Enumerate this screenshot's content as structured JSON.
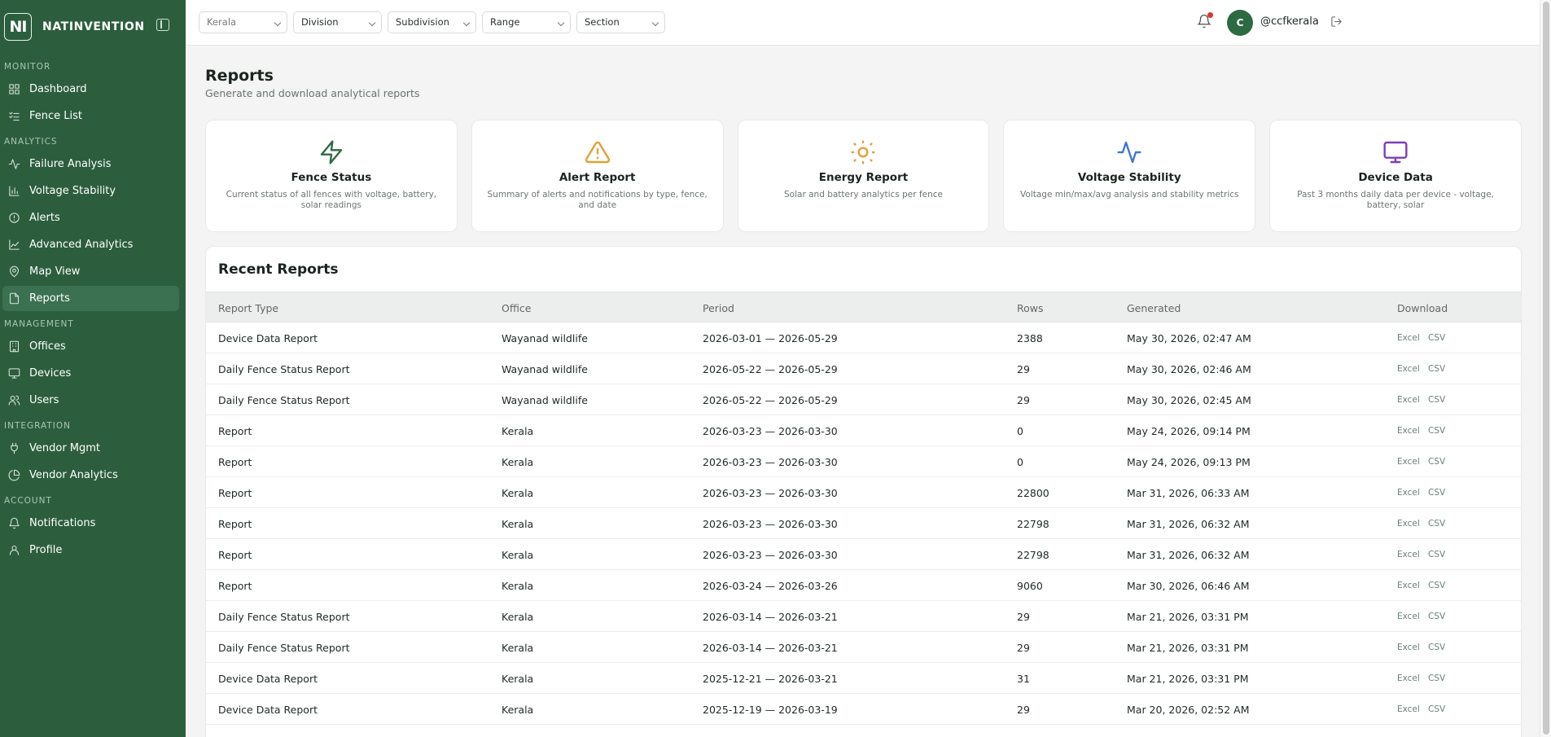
{
  "brand": {
    "logo": "NI",
    "name": "NATINVENTION"
  },
  "sidebar": {
    "sections": [
      {
        "label": "MONITOR",
        "items": [
          {
            "label": "Dashboard",
            "icon": "grid-icon"
          },
          {
            "label": "Fence List",
            "icon": "list-icon"
          }
        ]
      },
      {
        "label": "ANALYTICS",
        "items": [
          {
            "label": "Failure Analysis",
            "icon": "activity-icon"
          },
          {
            "label": "Voltage Stability",
            "icon": "bar-chart-icon"
          },
          {
            "label": "Alerts",
            "icon": "alert-circle-icon"
          },
          {
            "label": "Advanced Analytics",
            "icon": "line-chart-icon"
          },
          {
            "label": "Map View",
            "icon": "map-pin-icon"
          },
          {
            "label": "Reports",
            "icon": "file-icon",
            "active": true
          }
        ]
      },
      {
        "label": "MANAGEMENT",
        "items": [
          {
            "label": "Offices",
            "icon": "building-icon"
          },
          {
            "label": "Devices",
            "icon": "monitor-icon"
          },
          {
            "label": "Users",
            "icon": "users-icon"
          }
        ]
      },
      {
        "label": "INTEGRATION",
        "items": [
          {
            "label": "Vendor Mgmt",
            "icon": "plug-icon"
          },
          {
            "label": "Vendor Analytics",
            "icon": "pie-chart-icon"
          }
        ]
      },
      {
        "label": "ACCOUNT",
        "items": [
          {
            "label": "Notifications",
            "icon": "bell-icon"
          },
          {
            "label": "Profile",
            "icon": "user-icon"
          }
        ]
      }
    ]
  },
  "topbar": {
    "filters": [
      "Kerala",
      "Division",
      "Subdivision",
      "Range",
      "Section"
    ],
    "avatar_initial": "C",
    "username": "@ccfkerala"
  },
  "page": {
    "title": "Reports",
    "subtitle": "Generate and download analytical reports"
  },
  "cards": [
    {
      "title": "Fence Status",
      "desc": "Current status of all fences with voltage, battery, solar readings",
      "icon": "zap-icon",
      "color": "#2f6a47"
    },
    {
      "title": "Alert Report",
      "desc": "Summary of alerts and notifications by type, fence, and date",
      "icon": "warning-triangle-icon",
      "color": "#e0a13a"
    },
    {
      "title": "Energy Report",
      "desc": "Solar and battery analytics per fence",
      "icon": "sun-icon",
      "color": "#e0a13a"
    },
    {
      "title": "Voltage Stability",
      "desc": "Voltage min/max/avg analysis and stability metrics",
      "icon": "pulse-icon",
      "color": "#3f78c9"
    },
    {
      "title": "Device Data",
      "desc": "Past 3 months daily data per device - voltage, battery, solar",
      "icon": "monitor-icon",
      "color": "#7a3fb8"
    }
  ],
  "recent": {
    "title": "Recent Reports",
    "headers": [
      "Report Type",
      "Office",
      "Period",
      "Rows",
      "Generated",
      "Download"
    ],
    "download_labels": [
      "Excel",
      "CSV"
    ],
    "rows": [
      [
        "Device Data Report",
        "Wayanad wildlife",
        "2026-03-01 — 2026-05-29",
        "2388",
        "May 30, 2026, 02:47 AM"
      ],
      [
        "Daily Fence Status Report",
        "Wayanad wildlife",
        "2026-05-22 — 2026-05-29",
        "29",
        "May 30, 2026, 02:46 AM"
      ],
      [
        "Daily Fence Status Report",
        "Wayanad wildlife",
        "2026-05-22 — 2026-05-29",
        "29",
        "May 30, 2026, 02:45 AM"
      ],
      [
        "Report",
        "Kerala",
        "2026-03-23 — 2026-03-30",
        "0",
        "May 24, 2026, 09:14 PM"
      ],
      [
        "Report",
        "Kerala",
        "2026-03-23 — 2026-03-30",
        "0",
        "May 24, 2026, 09:13 PM"
      ],
      [
        "Report",
        "Kerala",
        "2026-03-23 — 2026-03-30",
        "22800",
        "Mar 31, 2026, 06:33 AM"
      ],
      [
        "Report",
        "Kerala",
        "2026-03-23 — 2026-03-30",
        "22798",
        "Mar 31, 2026, 06:32 AM"
      ],
      [
        "Report",
        "Kerala",
        "2026-03-23 — 2026-03-30",
        "22798",
        "Mar 31, 2026, 06:32 AM"
      ],
      [
        "Report",
        "Kerala",
        "2026-03-24 — 2026-03-26",
        "9060",
        "Mar 30, 2026, 06:46 AM"
      ],
      [
        "Daily Fence Status Report",
        "Kerala",
        "2026-03-14 — 2026-03-21",
        "29",
        "Mar 21, 2026, 03:31 PM"
      ],
      [
        "Daily Fence Status Report",
        "Kerala",
        "2026-03-14 — 2026-03-21",
        "29",
        "Mar 21, 2026, 03:31 PM"
      ],
      [
        "Device Data Report",
        "Kerala",
        "2025-12-21 — 2026-03-21",
        "31",
        "Mar 21, 2026, 03:31 PM"
      ],
      [
        "Device Data Report",
        "Kerala",
        "2025-12-19 — 2026-03-19",
        "29",
        "Mar 20, 2026, 02:52 AM"
      ]
    ]
  }
}
